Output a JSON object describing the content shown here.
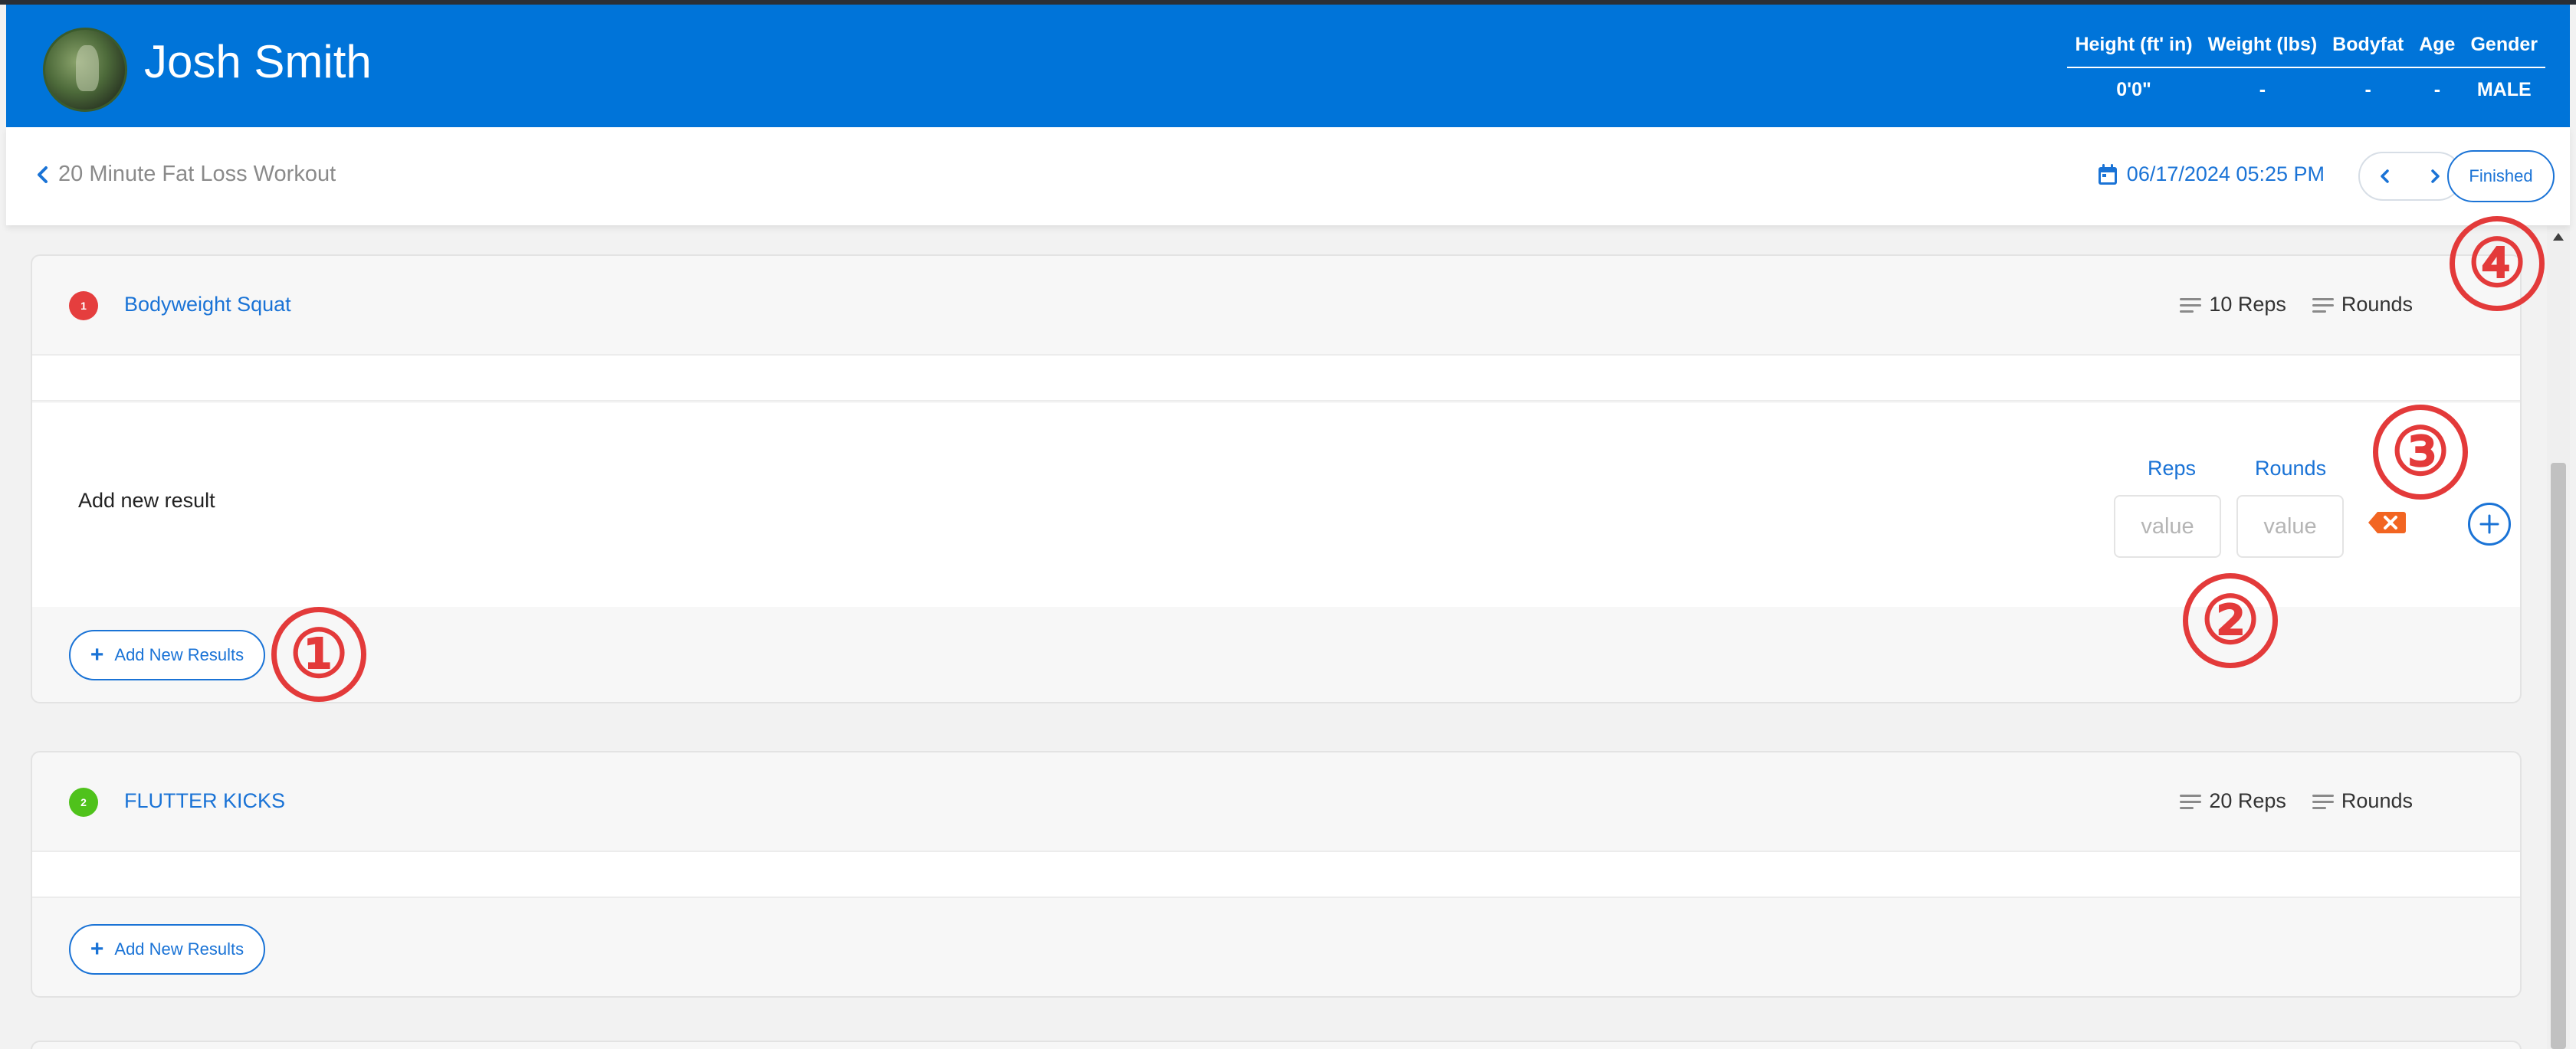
{
  "profile": {
    "name": "Josh Smith",
    "stats_headers": [
      "Height (ft' in)",
      "Weight (lbs)",
      "Bodyfat",
      "Age",
      "Gender"
    ],
    "stats_values": [
      "0'0\"",
      "-",
      "-",
      "-",
      "MALE"
    ]
  },
  "workout": {
    "back_icon": "chevron-left-icon",
    "title": "20 Minute Fat Loss Workout",
    "date": "06/17/2024 05:25 PM",
    "finished_label": "Finished"
  },
  "exercises": [
    {
      "number": "1",
      "badge_color": "#e53e3e",
      "name": "Bodyweight Squat",
      "reps_label": "10 Reps",
      "rounds_label": "Rounds",
      "add_result_label": "Add new result",
      "reps_header": "Reps",
      "rounds_header": "Rounds",
      "reps_placeholder": "value",
      "rounds_placeholder": "value",
      "add_new_results_label": "Add New Results"
    },
    {
      "number": "2",
      "badge_color": "#4fc21b",
      "name": "FLUTTER KICKS",
      "reps_label": "20 Reps",
      "rounds_label": "Rounds",
      "add_new_results_label": "Add New Results"
    }
  ],
  "annotations": [
    "①",
    "②",
    "③",
    "④"
  ],
  "colors": {
    "header_blue": "#0074d9",
    "accent_blue": "#1a73d6",
    "delete_orange": "#f26522",
    "annotation_red": "#e33a3a"
  }
}
